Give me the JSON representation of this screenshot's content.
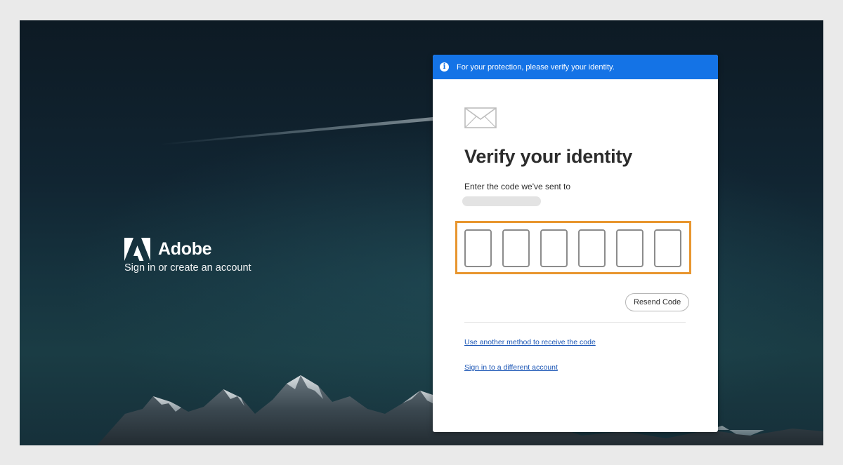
{
  "brand": {
    "name": "Adobe",
    "tagline": "Sign in or create an account"
  },
  "banner": {
    "icon": "info-icon",
    "text": "For your protection, please verify your identity."
  },
  "verify": {
    "icon": "envelope-icon",
    "title": "Verify your identity",
    "prompt": "Enter the code we've sent to",
    "code_digits": [
      "",
      "",
      "",
      "",
      "",
      ""
    ],
    "resend_label": "Resend Code",
    "alt_method_link": "Use another method to receive the code",
    "different_account_link": "Sign in to a different account"
  },
  "colors": {
    "banner_blue": "#1473e6",
    "highlight_orange": "#e8962f",
    "link_blue": "#1a55b5"
  }
}
